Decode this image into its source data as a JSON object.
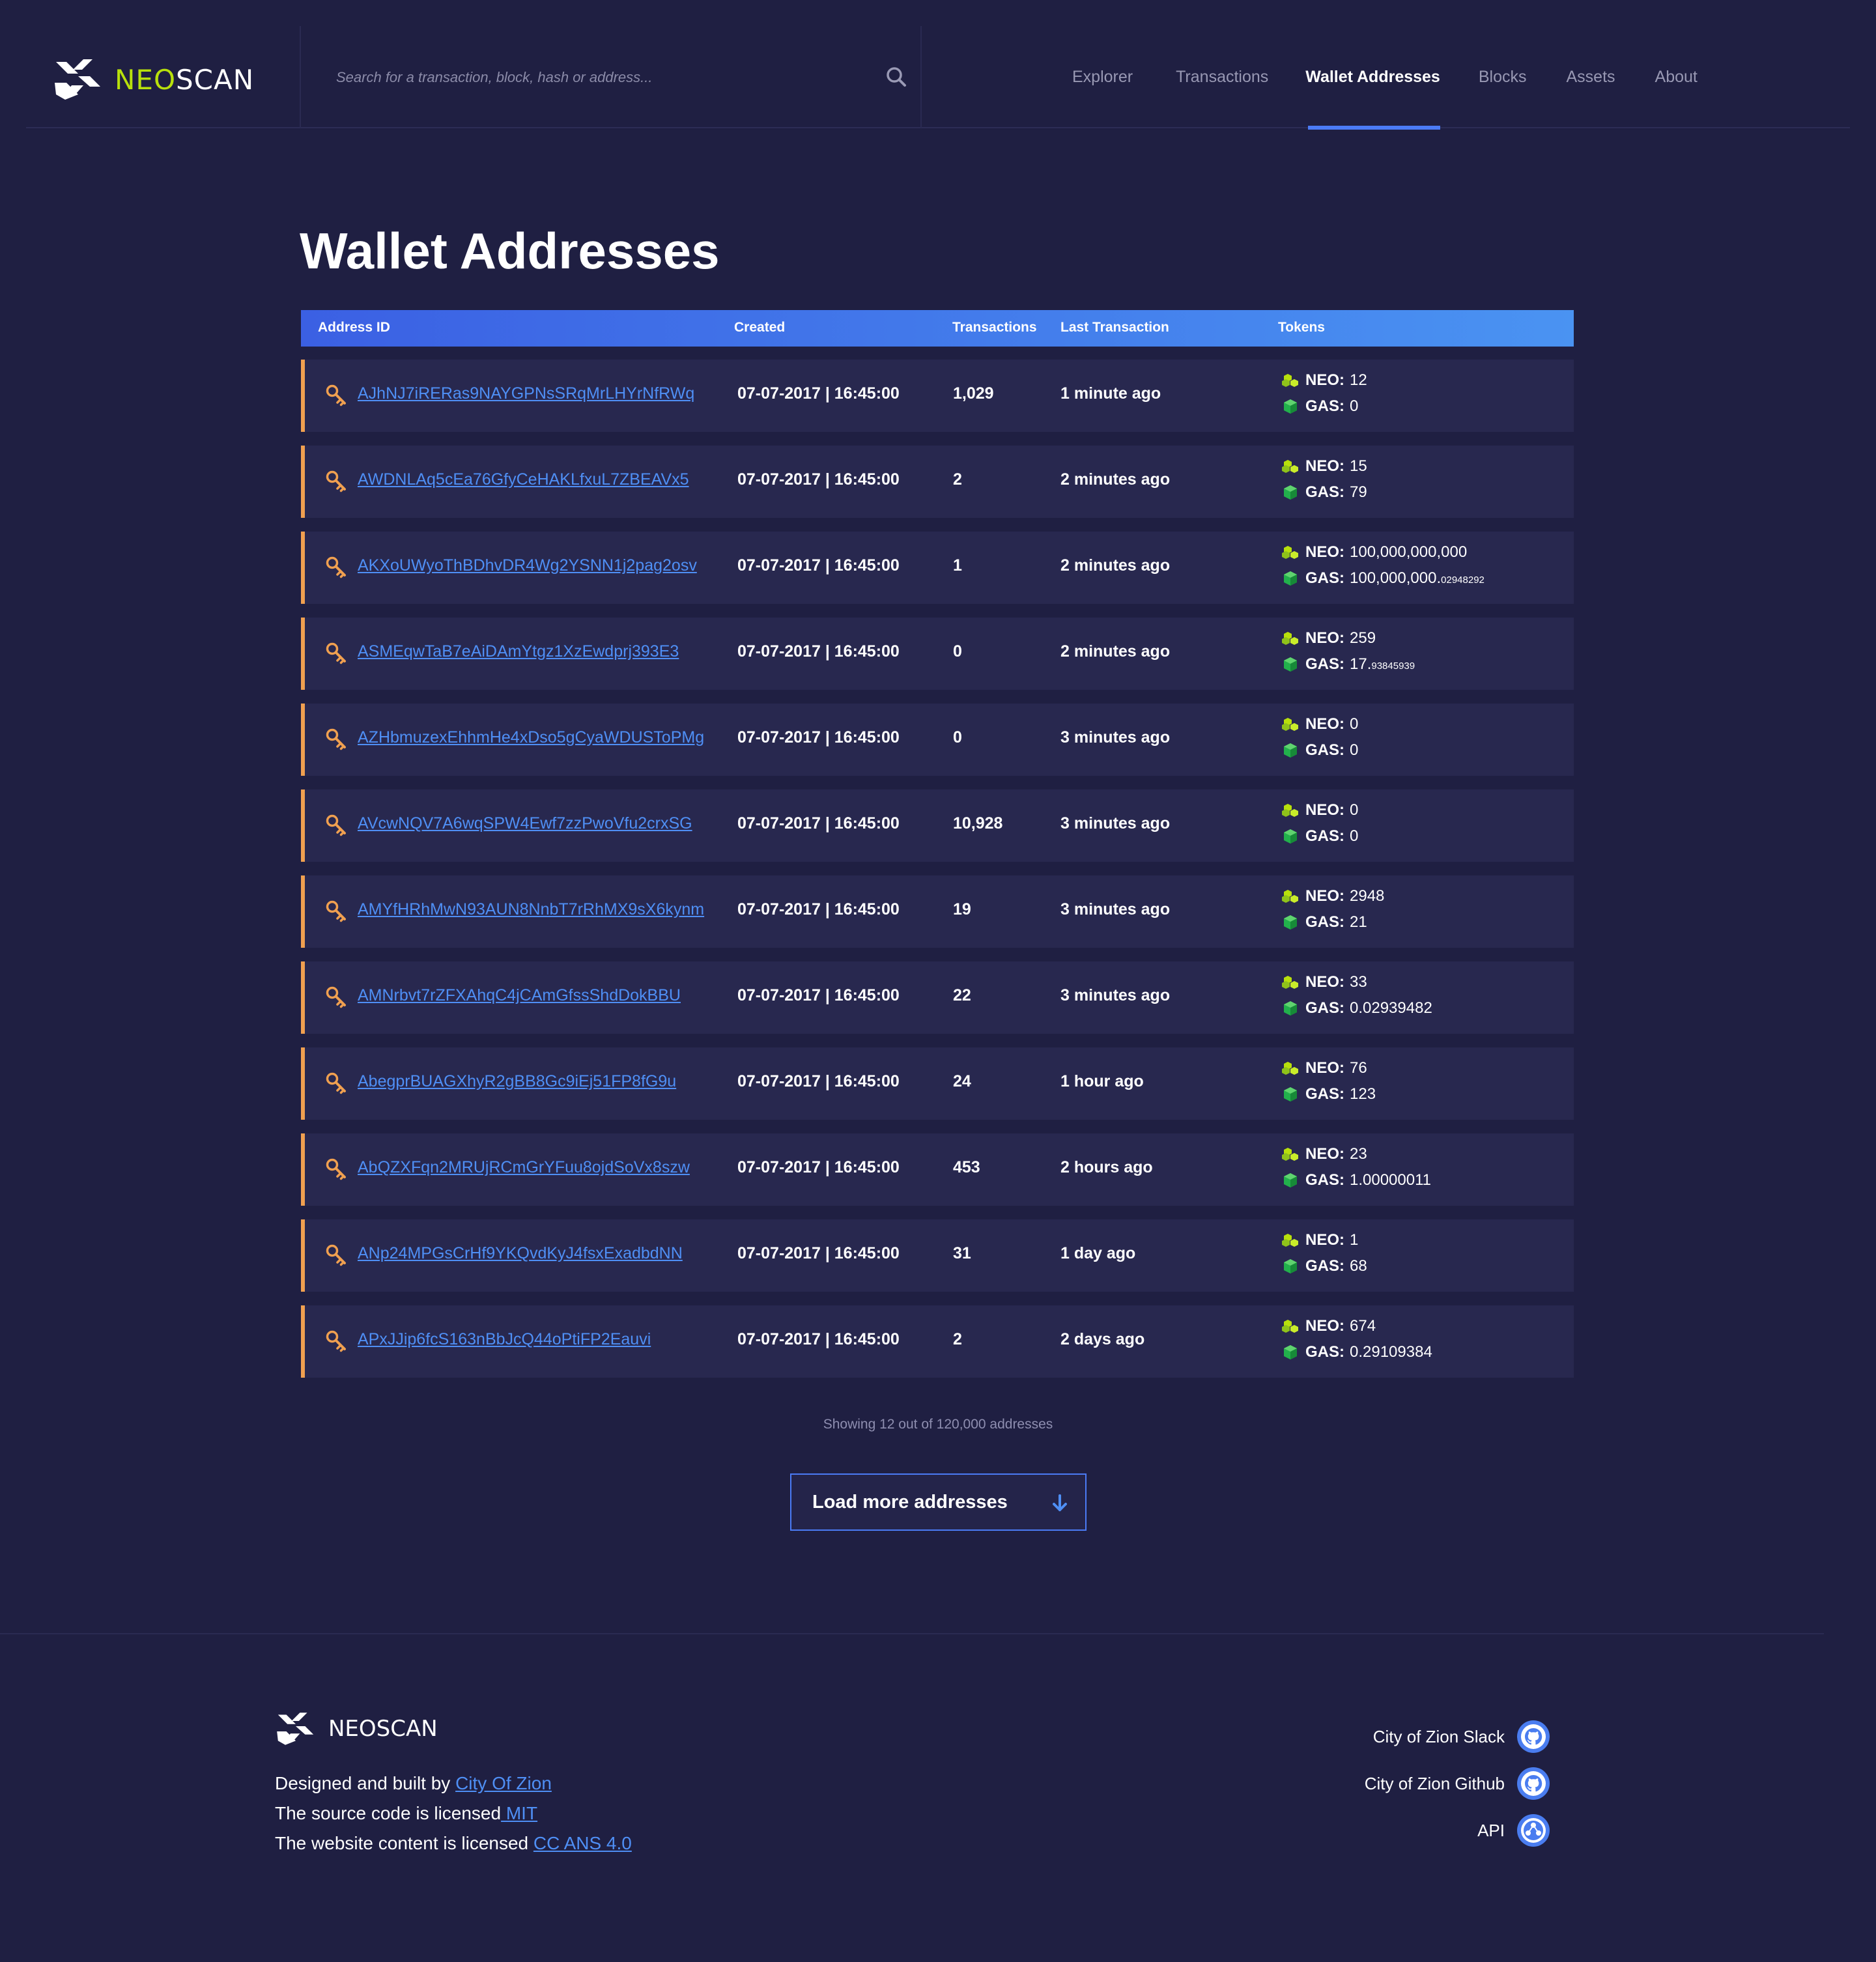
{
  "header": {
    "logo": {
      "part1": "NEO",
      "part2": "SCAN"
    },
    "search_placeholder": "Search for a transaction, block, hash or address...",
    "nav": [
      {
        "label": "Explorer",
        "active": false
      },
      {
        "label": "Transactions",
        "active": false
      },
      {
        "label": "Wallet Addresses",
        "active": true
      },
      {
        "label": "Blocks",
        "active": false
      },
      {
        "label": "Assets",
        "active": false
      },
      {
        "label": "About",
        "active": false
      }
    ]
  },
  "page": {
    "title": "Wallet Addresses"
  },
  "table": {
    "columns": [
      "Address ID",
      "Created",
      "Transactions",
      "Last Transaction",
      "Tokens"
    ],
    "neo_label": "NEO:",
    "gas_label": "GAS:",
    "rows": [
      {
        "address": "AJhNJ7iRERas9NAYGPNsSRqMrLHYrNfRWq",
        "created": "07-07-2017 | 16:45:00",
        "transactions": "1,029",
        "last": "1 minute ago",
        "neo": "12",
        "gas": "0",
        "gas_small": ""
      },
      {
        "address": "AWDNLAq5cEa76GfyCeHAKLfxuL7ZBEAVx5",
        "created": "07-07-2017 | 16:45:00",
        "transactions": "2",
        "last": "2 minutes ago",
        "neo": "15",
        "gas": "79",
        "gas_small": ""
      },
      {
        "address": "AKXoUWyoThBDhvDR4Wg2YSNN1j2pag2osv",
        "created": "07-07-2017 | 16:45:00",
        "transactions": "1",
        "last": "2 minutes ago",
        "neo": "100,000,000,000",
        "gas": "100,000,000.",
        "gas_small": "02948292"
      },
      {
        "address": "ASMEqwTaB7eAiDAmYtgz1XzEwdprj393E3",
        "created": "07-07-2017 | 16:45:00",
        "transactions": "0",
        "last": "2 minutes ago",
        "neo": "259",
        "gas": "17.",
        "gas_small": "93845939"
      },
      {
        "address": "AZHbmuzexEhhmHe4xDso5gCyaWDUSToPMg",
        "created": "07-07-2017 | 16:45:00",
        "transactions": "0",
        "last": "3 minutes ago",
        "neo": "0",
        "gas": "0",
        "gas_small": ""
      },
      {
        "address": "AVcwNQV7A6wqSPW4Ewf7zzPwoVfu2crxSG",
        "created": "07-07-2017 | 16:45:00",
        "transactions": "10,928",
        "last": "3 minutes ago",
        "neo": "0",
        "gas": "0",
        "gas_small": ""
      },
      {
        "address": "AMYfHRhMwN93AUN8NnbT7rRhMX9sX6kynm",
        "created": "07-07-2017 | 16:45:00",
        "transactions": "19",
        "last": "3 minutes ago",
        "neo": "2948",
        "gas": "21",
        "gas_small": ""
      },
      {
        "address": "AMNrbvt7rZFXAhqC4jCAmGfssShdDokBBU",
        "created": "07-07-2017 | 16:45:00",
        "transactions": "22",
        "last": "3 minutes ago",
        "neo": "33",
        "gas": "0.02939482",
        "gas_small": ""
      },
      {
        "address": "AbegprBUAGXhyR2gBB8Gc9iEj51FP8fG9u",
        "created": "07-07-2017 | 16:45:00",
        "transactions": "24",
        "last": "1 hour ago",
        "neo": "76",
        "gas": "123",
        "gas_small": ""
      },
      {
        "address": "AbQZXFqn2MRUjRCmGrYFuu8ojdSoVx8szw",
        "created": "07-07-2017 | 16:45:00",
        "transactions": "453",
        "last": "2 hours ago",
        "neo": "23",
        "gas": "1.00000011",
        "gas_small": ""
      },
      {
        "address": "ANp24MPGsCrHf9YKQvdKyJ4fsxExadbdNN",
        "created": "07-07-2017 | 16:45:00",
        "transactions": "31",
        "last": "1 day ago",
        "neo": "1",
        "gas": "68",
        "gas_small": ""
      },
      {
        "address": "APxJJip6fcS163nBbJcQ44oPtiFP2Eauvi",
        "created": "07-07-2017 | 16:45:00",
        "transactions": "2",
        "last": "2 days ago",
        "neo": "674",
        "gas": "0.29109384",
        "gas_small": ""
      }
    ]
  },
  "showing": "Showing 12 out of 120,000 addresses",
  "load_more": "Load more addresses",
  "footer": {
    "logo_text": "NEOSCAN",
    "designed_prefix": "Designed and built by ",
    "designed_link": "City Of Zion",
    "source_prefix": "The source code is licensed",
    "source_link": " MIT",
    "content_prefix": "The website content is licensed ",
    "content_link": "CC ANS 4.0",
    "links": [
      {
        "label": "City of Zion Slack",
        "icon": "github-icon"
      },
      {
        "label": "City of Zion Github",
        "icon": "github-icon"
      },
      {
        "label": "API",
        "icon": "api-icon"
      }
    ]
  },
  "colors": {
    "background": "#1f1f42",
    "row_bg": "#28284f",
    "row_accent": "#f0a050",
    "link": "#4f8ff5",
    "logo_green": "#b8e00c",
    "header_gradient_start": "#3b60e3",
    "header_gradient_end": "#4a93f2"
  }
}
